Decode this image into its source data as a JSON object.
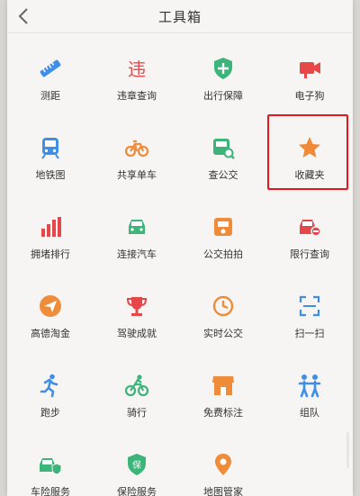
{
  "header": {
    "title": "工具箱"
  },
  "tools": [
    {
      "label": "测距",
      "icon": "ruler-icon"
    },
    {
      "label": "违章查询",
      "icon": "violation-icon"
    },
    {
      "label": "出行保障",
      "icon": "shield-plus-icon"
    },
    {
      "label": "电子狗",
      "icon": "camera-icon"
    },
    {
      "label": "地铁图",
      "icon": "subway-icon"
    },
    {
      "label": "共享单车",
      "icon": "bicycle-icon"
    },
    {
      "label": "查公交",
      "icon": "bus-search-icon"
    },
    {
      "label": "收藏夹",
      "icon": "star-icon"
    },
    {
      "label": "拥堵排行",
      "icon": "bar-chart-icon"
    },
    {
      "label": "连接汽车",
      "icon": "car-icon"
    },
    {
      "label": "公交拍拍",
      "icon": "bus-camera-icon"
    },
    {
      "label": "限行查询",
      "icon": "car-restricted-icon"
    },
    {
      "label": "高德淘金",
      "icon": "paper-plane-icon"
    },
    {
      "label": "驾驶成就",
      "icon": "trophy-icon"
    },
    {
      "label": "实时公交",
      "icon": "clock-icon"
    },
    {
      "label": "扫一扫",
      "icon": "scan-icon"
    },
    {
      "label": "跑步",
      "icon": "runner-icon"
    },
    {
      "label": "骑行",
      "icon": "cyclist-icon"
    },
    {
      "label": "免费标注",
      "icon": "shop-icon"
    },
    {
      "label": "组队",
      "icon": "group-icon"
    },
    {
      "label": "车险服务",
      "icon": "car-insurance-icon"
    },
    {
      "label": "保险服务",
      "icon": "insurance-shield-icon"
    },
    {
      "label": "地图管家",
      "icon": "map-pin-icon"
    }
  ],
  "colors": {
    "blue": "#3f8fe8",
    "red": "#e6484a",
    "green": "#3cb47a",
    "orange": "#ee8c3a",
    "star": "#f08a3b",
    "highlight": "#e8161c"
  }
}
